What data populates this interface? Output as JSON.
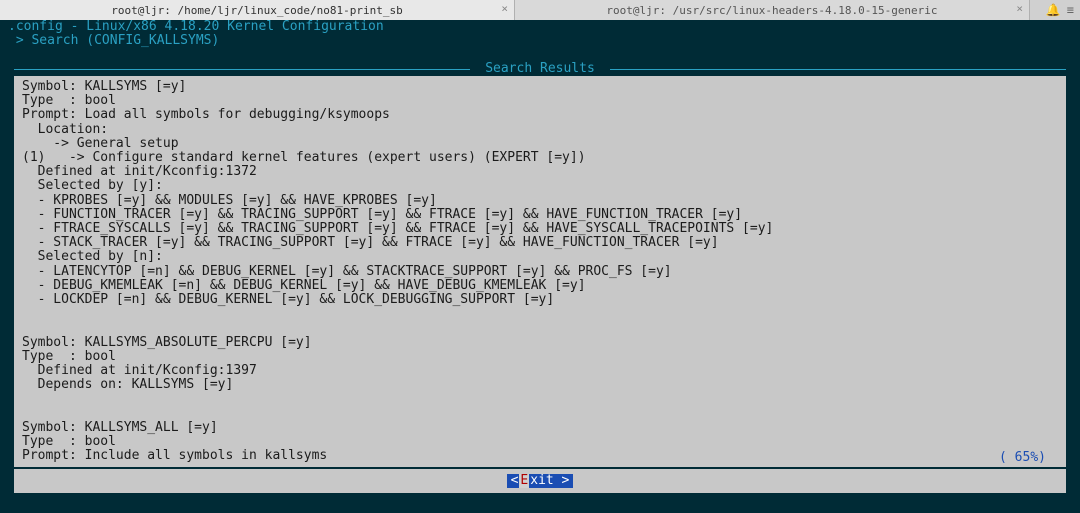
{
  "tabs": [
    {
      "title": "root@ljr: /home/ljr/linux_code/no81-print_sb",
      "active": true
    },
    {
      "title": "root@ljr: /usr/src/linux-headers-4.18.0-15-generic",
      "active": false
    }
  ],
  "header": {
    "title_line": ".config - Linux/x86 4.18.20 Kernel Configuration",
    "breadcrumb": " > Search (CONFIG_KALLSYMS) ",
    "results_label": "Search Results"
  },
  "results": [
    "Symbol: KALLSYMS [=y]",
    "Type  : bool",
    "Prompt: Load all symbols for debugging/ksymoops",
    "  Location:",
    "    -> General setup",
    "(1)   -> Configure standard kernel features (expert users) (EXPERT [=y])",
    "  Defined at init/Kconfig:1372",
    "  Selected by [y]:",
    "  - KPROBES [=y] && MODULES [=y] && HAVE_KPROBES [=y]",
    "  - FUNCTION_TRACER [=y] && TRACING_SUPPORT [=y] && FTRACE [=y] && HAVE_FUNCTION_TRACER [=y]",
    "  - FTRACE_SYSCALLS [=y] && TRACING_SUPPORT [=y] && FTRACE [=y] && HAVE_SYSCALL_TRACEPOINTS [=y]",
    "  - STACK_TRACER [=y] && TRACING_SUPPORT [=y] && FTRACE [=y] && HAVE_FUNCTION_TRACER [=y]",
    "  Selected by [n]:",
    "  - LATENCYTOP [=n] && DEBUG_KERNEL [=y] && STACKTRACE_SUPPORT [=y] && PROC_FS [=y]",
    "  - DEBUG_KMEMLEAK [=n] && DEBUG_KERNEL [=y] && HAVE_DEBUG_KMEMLEAK [=y]",
    "  - LOCKDEP [=n] && DEBUG_KERNEL [=y] && LOCK_DEBUGGING_SUPPORT [=y]",
    "",
    "",
    "Symbol: KALLSYMS_ABSOLUTE_PERCPU [=y]",
    "Type  : bool",
    "  Defined at init/Kconfig:1397",
    "  Depends on: KALLSYMS [=y]",
    "",
    "",
    "Symbol: KALLSYMS_ALL [=y]",
    "Type  : bool",
    "Prompt: Include all symbols in kallsyms"
  ],
  "footer": {
    "exit_prefix": "< ",
    "exit_hotkey": "E",
    "exit_rest": "xit >",
    "percent": "(  65%)"
  }
}
